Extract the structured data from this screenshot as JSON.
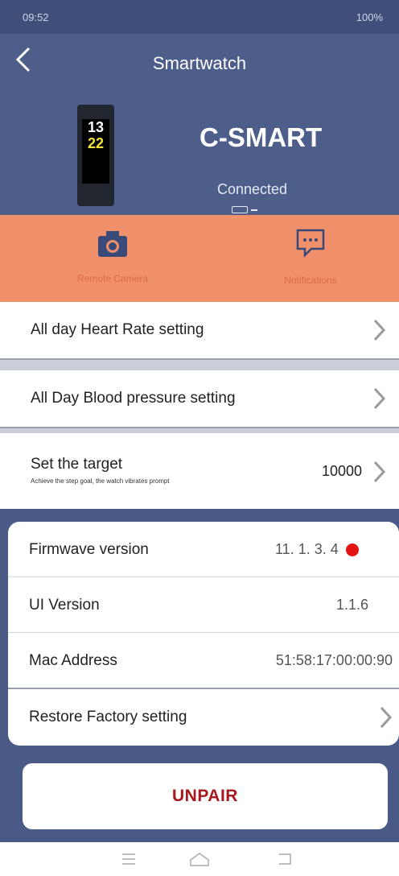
{
  "status_bar": {
    "time": "09:52",
    "left_icons": "46",
    "right_icons": "100%"
  },
  "header": {
    "back_label": "<",
    "title": "Smartwatch",
    "device_name": "C-SMART",
    "connection_status": "Connected",
    "watch_screen": {
      "hour": "13",
      "minute": "22"
    }
  },
  "quick_actions": [
    {
      "label": "Remote Camera",
      "icon": "camera-icon"
    },
    {
      "label": "Notifications",
      "icon": "message-icon"
    }
  ],
  "settings": {
    "heart_rate": "All day Heart Rate setting",
    "blood_pressure": "All Day Blood pressure setting",
    "target": {
      "label": "Set the target",
      "subtitle": "Achieve the step goal, the watch vibrates prompt",
      "value": "10000"
    }
  },
  "info": {
    "firmware": {
      "label": "Firmwave version",
      "value": "11. 1. 3. 4"
    },
    "ui": {
      "label": "UI Version",
      "value": "1.1.6"
    },
    "mac": {
      "label": "Mac Address",
      "value": "51:58:17:00:00:90"
    },
    "restore": {
      "label": "Restore Factory setting"
    }
  },
  "unpair_label": "UNPAIR",
  "colors": {
    "header_bg": "#4e5e8b",
    "quickbar_bg": "#f0916b",
    "unpair_text": "#a8191f",
    "update_dot": "#e41414"
  }
}
